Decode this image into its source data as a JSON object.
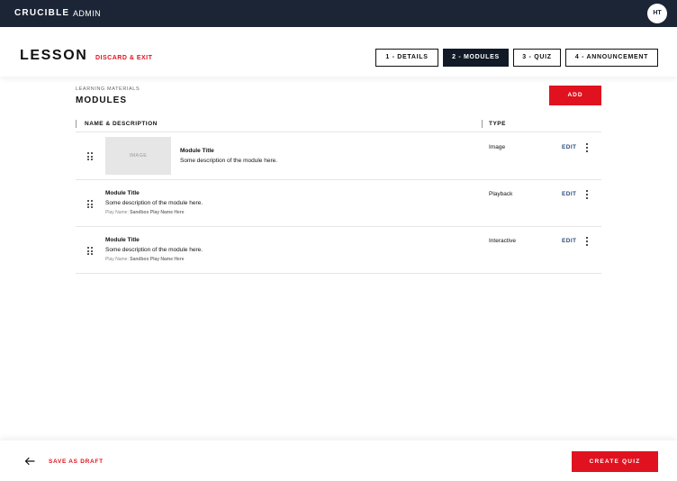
{
  "app": {
    "brand": "CRUCIBLE",
    "brand_sub": "ADMIN",
    "avatar_initials": "HT"
  },
  "header": {
    "title": "LESSON",
    "discard_label": "DISCARD & EXIT",
    "steps": [
      {
        "label": "1 - DETAILS",
        "active": false
      },
      {
        "label": "2 - MODULES",
        "active": true
      },
      {
        "label": "3 - QUIZ",
        "active": false
      },
      {
        "label": "4 - ANNOUNCEMENT",
        "active": false
      }
    ]
  },
  "section": {
    "eyebrow": "LEARNING MATERIALS",
    "title": "MODULES",
    "add_label": "ADD"
  },
  "table": {
    "columns": [
      "NAME & DESCRIPTION",
      "TYPE"
    ],
    "rows": [
      {
        "thumbnail": "IMAGE",
        "title": "Module Title",
        "description": "Some description of the module here.",
        "play_label": "",
        "play_name": "",
        "type": "Image",
        "edit_label": "EDIT"
      },
      {
        "thumbnail": "",
        "title": "Module Title",
        "description": "Some description of the module here.",
        "play_label": "Play Name:",
        "play_name": "Sandbox Play Name Here",
        "type": "Playback",
        "edit_label": "EDIT"
      },
      {
        "thumbnail": "",
        "title": "Module Title",
        "description": "Some description of the module here.",
        "play_label": "Play Name:",
        "play_name": "Sandbox Play Name Here",
        "type": "Interactive",
        "edit_label": "EDIT"
      }
    ]
  },
  "footer": {
    "save_draft_label": "SAVE AS DRAFT",
    "create_label": "CREATE QUIZ"
  },
  "colors": {
    "topbar": "#1c2536",
    "accent_red": "#e0121f",
    "active_step": "#111b27",
    "edit_link": "#2c4f7c"
  },
  "icons": [
    "back-arrow-icon",
    "drag-handle-icon",
    "more-vertical-icon"
  ]
}
